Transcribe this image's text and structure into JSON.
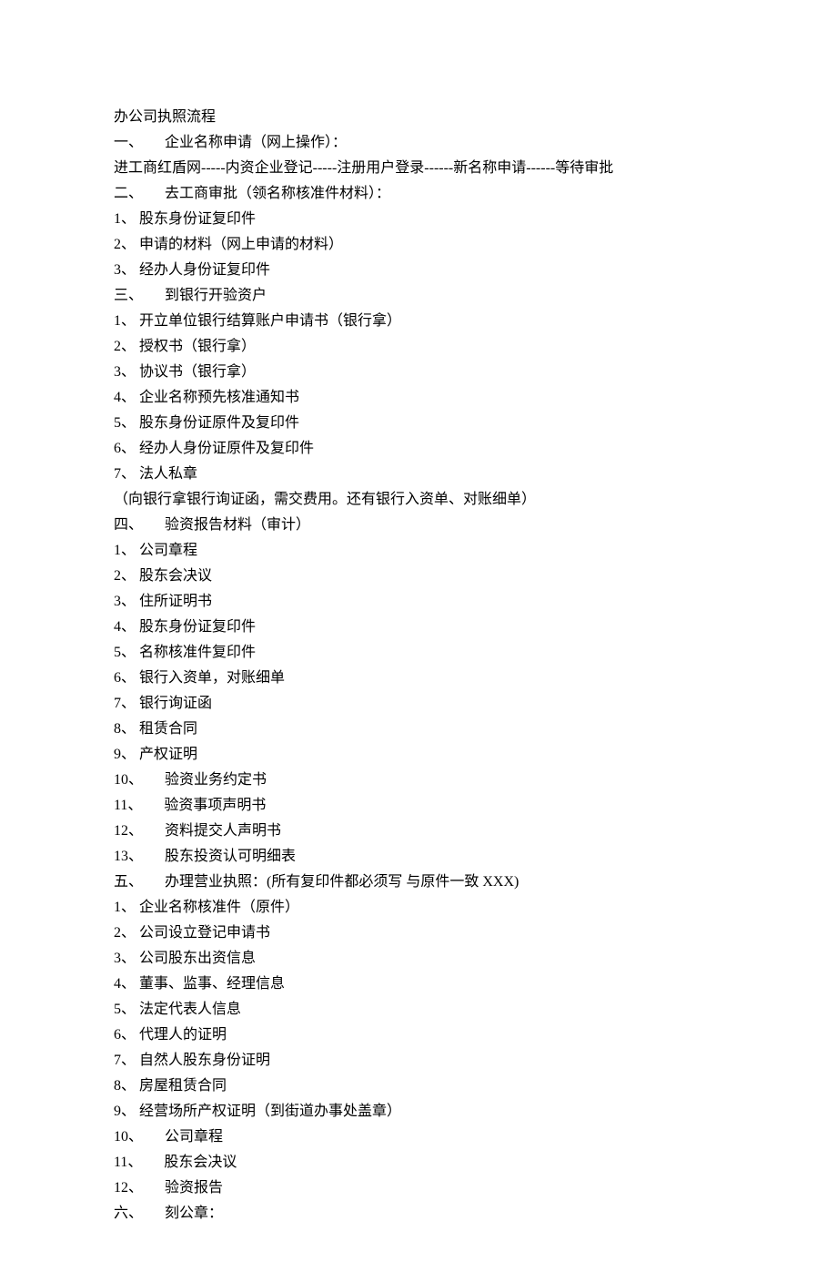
{
  "lines": [
    "办公司执照流程",
    "一、      企业名称申请（网上操作）：",
    "进工商红盾网-----内资企业登记-----注册用户登录------新名称申请------等待审批",
    "二、      去工商审批（领名称核准件材料）：",
    "1、 股东身份证复印件",
    "2、 申请的材料（网上申请的材料）",
    "3、 经办人身份证复印件",
    "三、      到银行开验资户",
    "1、 开立单位银行结算账户申请书（银行拿）",
    "2、 授权书（银行拿）",
    "3、 协议书（银行拿）",
    "4、 企业名称预先核准通知书",
    "5、 股东身份证原件及复印件",
    "6、 经办人身份证原件及复印件",
    "7、 法人私章",
    "（向银行拿银行询证函，需交费用。还有银行入资单、对账细单）",
    "四、      验资报告材料（审计）",
    "1、 公司章程",
    "2、 股东会决议",
    "3、 住所证明书",
    "4、 股东身份证复印件",
    "5、 名称核准件复印件",
    "6、 银行入资单，对账细单",
    "7、 银行询证函",
    "8、 租赁合同",
    "9、 产权证明",
    "10、      验资业务约定书",
    "11、      验资事项声明书",
    "12、      资料提交人声明书",
    "13、      股东投资认可明细表",
    "五、      办理营业执照：(所有复印件都必须写 与原件一致 XXX)",
    "1、 企业名称核准件（原件）",
    "2、 公司设立登记申请书",
    "3、 公司股东出资信息",
    "4、 董事、监事、经理信息",
    "5、 法定代表人信息",
    "6、 代理人的证明",
    "7、 自然人股东身份证明",
    "8、 房屋租赁合同",
    "9、 经营场所产权证明（到街道办事处盖章）",
    "10、      公司章程",
    "11、      股东会决议",
    "12、      验资报告",
    "六、      刻公章："
  ]
}
